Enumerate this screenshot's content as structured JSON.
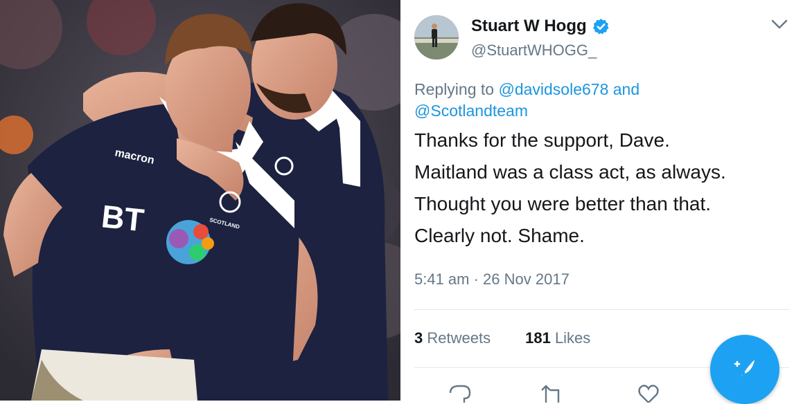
{
  "tweet": {
    "author_name": "Stuart W Hogg",
    "handle": "@StuartWHOGG_",
    "replying_prefix": "Replying to",
    "mention_1": "@davidsole678",
    "mention_joiner": "and",
    "mention_2": "@Scotlandteam",
    "lines": [
      "Thanks for the support, Dave.",
      "Maitland was a class act, as always.",
      "Thought you were better than that.",
      "Clearly not. Shame."
    ],
    "timestamp": "5:41 am · 26 Nov 2017",
    "retweets_count": "3",
    "retweets_label": "Retweets",
    "likes_count": "181",
    "likes_label": "Likes"
  },
  "photo": {
    "shirt_brand": "macron",
    "sponsor": "BT",
    "crest_text": "SCOTLAND"
  },
  "colors": {
    "link": "#1b95e0",
    "accent": "#1da1f2",
    "secondary_text": "#657786",
    "jersey_navy": "#1c2240"
  },
  "icons": [
    "verified-badge-icon",
    "chevron-down-icon",
    "reply-icon",
    "retweet-icon",
    "like-icon",
    "compose-tweet-icon"
  ]
}
